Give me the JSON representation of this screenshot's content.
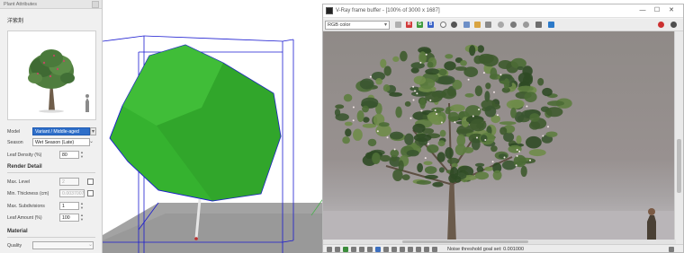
{
  "plant_panel": {
    "window_title": "Plant Attributes",
    "plant_name": "洋紫荆",
    "model": {
      "label": "Model",
      "value": "Variant / Middle-aged"
    },
    "season": {
      "label": "Season",
      "value": "Wet Season (Late)"
    },
    "leaf_density": {
      "label": "Leaf Density (%)",
      "value": "80"
    },
    "render_detail": {
      "heading": "Render Detail",
      "max_level": {
        "label": "Max. Level",
        "value": "2"
      },
      "min_thickness": {
        "label": "Min. Thickness (cm)",
        "value": "0.0037007"
      },
      "max_subdivisions": {
        "label": "Max. Subdivisions",
        "value": "1"
      },
      "leaf_amount": {
        "label": "Leaf Amount (%)",
        "value": "100"
      }
    },
    "material": {
      "heading": "Material",
      "quality": {
        "label": "Quality",
        "value": ""
      }
    }
  },
  "viewport": {
    "canopy_color": "#35b22f",
    "box_color": "#1a1ad0"
  },
  "frame_buffer": {
    "title": "V-Ray frame buffer - [100% of 3000 x 1687]",
    "channel": "RGB color",
    "status": "Noise threshold goal set: 0.001000",
    "window_buttons": [
      "—",
      "☐",
      "✕"
    ],
    "toolbar_letters": [
      "R",
      "G",
      "B"
    ]
  }
}
